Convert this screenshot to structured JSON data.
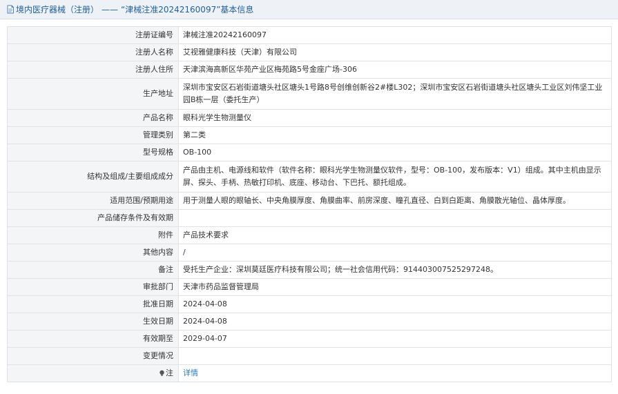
{
  "header": {
    "section": "境内医疗器械（注册）",
    "separator": "——",
    "record_title": "“津械注准20242160097”基本信息"
  },
  "rows": [
    {
      "label": "注册证编号",
      "value": "津械注准20242160097"
    },
    {
      "label": "注册人名称",
      "value": "艾视雅健康科技（天津）有限公司"
    },
    {
      "label": "注册人住所",
      "value": "天津滨海高新区华苑产业区梅苑路5号金座广场-306"
    },
    {
      "label": "生产地址",
      "value": "深圳市宝安区石岩街道塘头社区塘头1号路8号创维创新谷2#楼L302；深圳市宝安区石岩街道塘头社区塘头工业区刘伟坚工业园B栋一层（委托生产）"
    },
    {
      "label": "产品名称",
      "value": "眼科光学生物测量仪"
    },
    {
      "label": "管理类别",
      "value": "第二类"
    },
    {
      "label": "型号规格",
      "value": "OB-100"
    },
    {
      "label": "结构及组成/主要组成成分",
      "value": "产品由主机、电源线和软件（软件名称：眼科光学生物测量仪软件，型号：OB-100，发布版本：V1）组成。其中主机由显示屏、探头、手柄、热敏打印机、底座、移动台、下巴托、额托组成。"
    },
    {
      "label": "适用范围/预期用途",
      "value": "用于测量人眼的眼轴长、中央角膜厚度、角膜曲率、前房深度、瞳孔直径、白到白距离、角膜散光轴位、晶体厚度。"
    },
    {
      "label": "产品储存条件及有效期",
      "value": ""
    },
    {
      "label": "附件",
      "value": "产品技术要求"
    },
    {
      "label": "其他内容",
      "value": "/"
    },
    {
      "label": "备注",
      "value": "受托生产企业：深圳莫廷医疗科技有限公司；统一社会信用代码：914403007525297248。"
    },
    {
      "label": "审批部门",
      "value": "天津市药品监督管理局"
    },
    {
      "label": "批准日期",
      "value": "2024-04-08"
    },
    {
      "label": "生效日期",
      "value": "2024-04-08"
    },
    {
      "label": "有效期至",
      "value": "2029-04-07"
    },
    {
      "label": "变更情况",
      "value": ""
    }
  ],
  "note": {
    "label": "注",
    "link_text": "详情"
  }
}
